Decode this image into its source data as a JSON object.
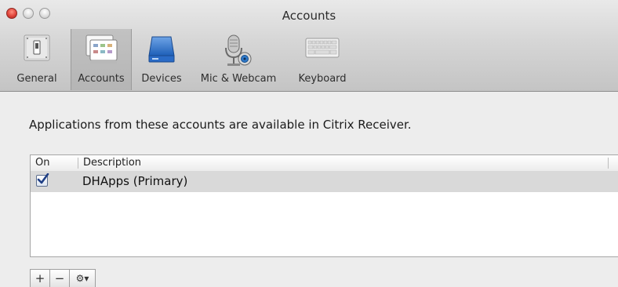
{
  "window": {
    "title": "Accounts"
  },
  "toolbar": {
    "items": [
      {
        "label": "General",
        "icon": "general-switch-icon",
        "selected": false
      },
      {
        "label": "Accounts",
        "icon": "accounts-icon",
        "selected": true
      },
      {
        "label": "Devices",
        "icon": "devices-icon",
        "selected": false
      },
      {
        "label": "Mic & Webcam",
        "icon": "mic-webcam-icon",
        "selected": false
      },
      {
        "label": "Keyboard",
        "icon": "keyboard-icon",
        "selected": false
      }
    ]
  },
  "content": {
    "intro": "Applications from these accounts are available in Citrix Receiver."
  },
  "table": {
    "columns": [
      "On",
      "Description"
    ],
    "rows": [
      {
        "on": true,
        "description": "DHApps (Primary)"
      }
    ]
  },
  "buttons": {
    "add": "+",
    "remove": "−",
    "gear": "⚙▾"
  },
  "colors": {
    "close": "#e0443a",
    "selected_row": "#d9d9d9",
    "checkbox_mark": "#1f3f85"
  }
}
